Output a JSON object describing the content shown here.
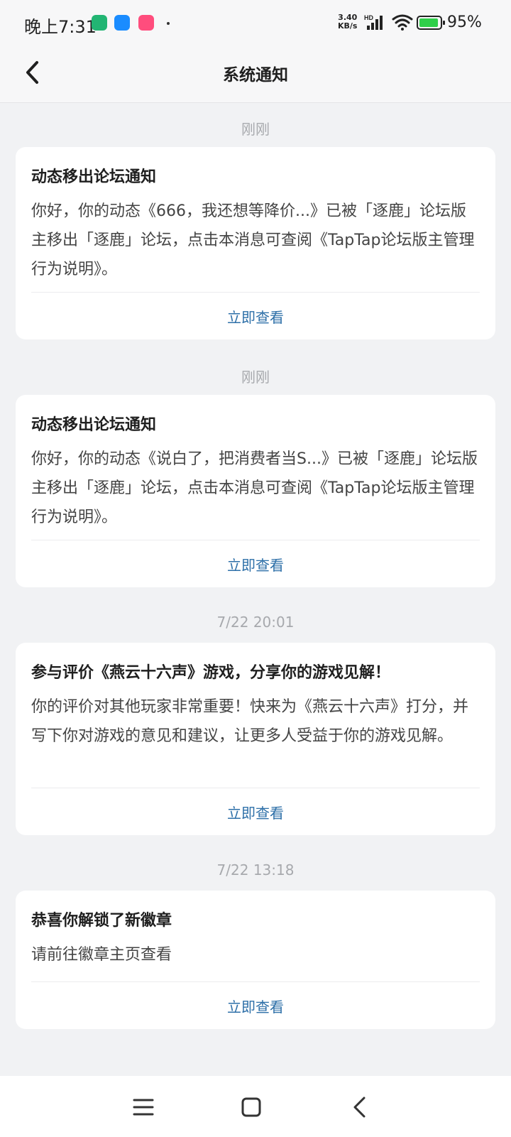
{
  "status_bar": {
    "time": "晚上7:31",
    "net_speed_value": "3.40",
    "net_speed_unit": "KB/s",
    "hd_label": "HD",
    "battery_percent": "95%"
  },
  "header": {
    "title": "系统通知"
  },
  "notifications": [
    {
      "time": "刚刚",
      "title": "动态移出论坛通知",
      "body": "你好，你的动态《666，我还想等降价...》已被「逐鹿」论坛版主移出「逐鹿」论坛，点击本消息可查阅《TapTap论坛版主管理行为说明》。",
      "action": "立即查看"
    },
    {
      "time": "刚刚",
      "title": "动态移出论坛通知",
      "body": "你好，你的动态《说白了，把消费者当S...》已被「逐鹿」论坛版主移出「逐鹿」论坛，点击本消息可查阅《TapTap论坛版主管理行为说明》。",
      "action": "立即查看"
    },
    {
      "time": "7/22  20:01",
      "title": "参与评价《燕云十六声》游戏，分享你的游戏见解！",
      "body": "你的评价对其他玩家非常重要！快来为《燕云十六声》打分，并写下你对游戏的意见和建议，让更多人受益于你的游戏见解。",
      "action": "立即查看"
    },
    {
      "time": "7/22  13:18",
      "title": "恭喜你解锁了新徽章",
      "body": "请前往徽章主页查看",
      "action": "立即查看"
    }
  ],
  "icons": {
    "back": "chevron-left-icon",
    "menu": "menu-icon",
    "home": "home-square-icon",
    "nav_back": "nav-back-icon"
  },
  "colors": {
    "accent": "#2d6fa8",
    "background": "#f1f2f4",
    "battery": "#2fcf4a"
  }
}
